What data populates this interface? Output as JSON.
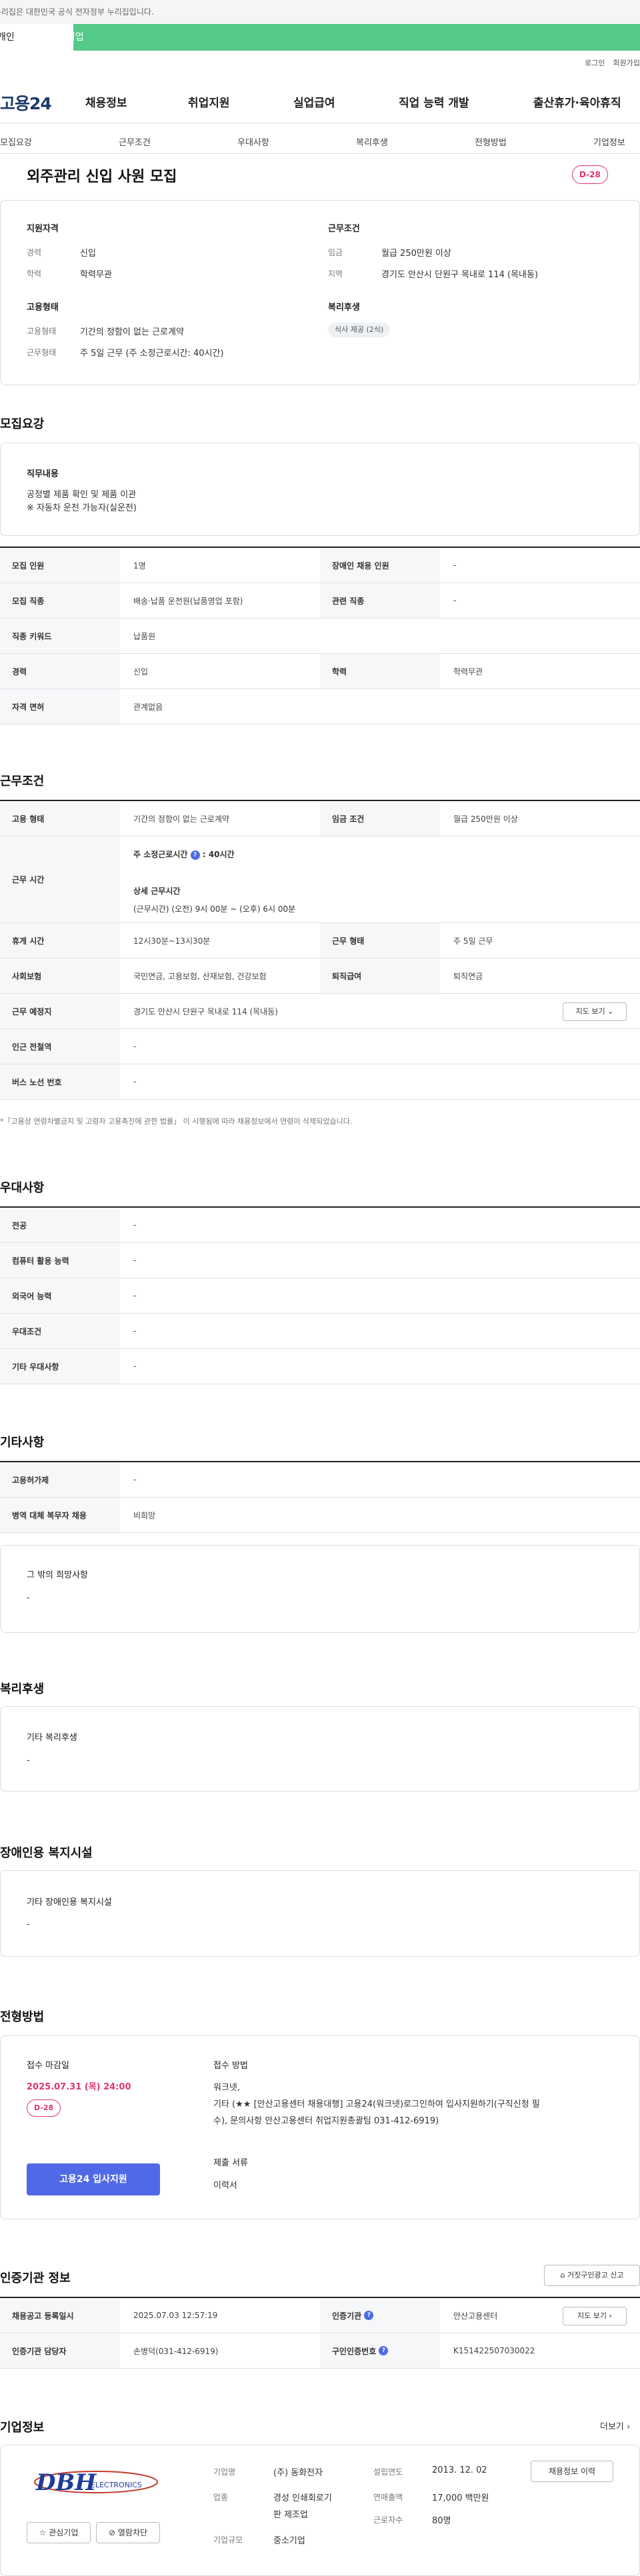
{
  "gov_banner": "이 누리집은 대한민국 공식 전자정부 누리집입니다.",
  "user_tabs": [
    "개인",
    "기업"
  ],
  "top_links": [
    "로그인",
    "회원가입"
  ],
  "logo": "고용24",
  "gnb": [
    "채용정보",
    "취업지원",
    "실업급여",
    "직업 능력 개발",
    "출산휴가·육아휴직"
  ],
  "lnb": [
    "모집요강",
    "근무조건",
    "우대사항",
    "복리후생",
    "전형방법",
    "기업정보"
  ],
  "title": "외주관리 신입 사원 모집",
  "dday": "D-28",
  "summary": {
    "qual_title": "지원자격",
    "career_l": "경력",
    "career_v": "신입",
    "edu_l": "학력",
    "edu_v": "학력무관",
    "cond_title": "근무조건",
    "wage_l": "임금",
    "wage_v": "월급 250만원 이상",
    "loc_l": "지역",
    "loc_v": "경기도 안산시 단원구 목내로 114 (목내동)",
    "emp_title": "고용형태",
    "type_l": "고용형태",
    "type_v": "기간의 정함이 없는 근로계약",
    "form_l": "근무형태",
    "form_v": "주 5일 근무 (주 소정근로시간: 40시간)",
    "welfare_title": "복리후생",
    "welfare_chip": "식사 제공 (2식)"
  },
  "recruit": {
    "title": "모집요강",
    "duty_l": "직무내용",
    "duty_1": "공정별 제품 확인 및 제품 이관",
    "duty_2": "※ 자동차 운전 가능자(실운전)",
    "rows": [
      [
        "모집 인원",
        "1명",
        "장애인 채용 인원",
        "-"
      ],
      [
        "모집 직종",
        "배송·납품 운전원(납품영업 포함)",
        "관련 직종",
        "-"
      ],
      [
        "직종 키워드",
        "납품원"
      ],
      [
        "경력",
        "신입",
        "학력",
        "학력무관"
      ],
      [
        "자격 면허",
        "관계없음"
      ]
    ]
  },
  "work": {
    "title": "근무조건",
    "r1": [
      "고용 형태",
      "기간의 정함이 없는 근로계약",
      "임금 조건",
      "월급 250만원 이상"
    ],
    "r2_l": "근무 시간",
    "r2_a": "주 소정근로시간",
    "r2_a2": ": 40시간",
    "r2_b": "상세 근무시간",
    "r2_c": "(근무시간) (오전) 9시 00분 ~ (오후) 6시 00분",
    "r3": [
      "휴게 시간",
      "12시30분~13시30분",
      "근무 형태",
      "주 5일 근무"
    ],
    "r4": [
      "사회보험",
      "국민연금, 고용보험, 산재보험, 건강보험",
      "퇴직급여",
      "퇴직연금"
    ],
    "r5": [
      "근무 예정지",
      "경기도 안산시 단원구 목내로 114 (목내동)"
    ],
    "map_btn": "지도 보기",
    "r6": [
      "인근 전철역",
      "-"
    ],
    "r7": [
      "버스 노선 번호",
      "-"
    ],
    "note": "「고용상 연령차별금지 및 고령자 고용촉진에 관한 법률」 이 시행됨에 따라 채용정보에서 연령이 삭제되었습니다."
  },
  "pref": {
    "title": "우대사항",
    "rows": [
      [
        "전공",
        "-"
      ],
      [
        "컴퓨터 활용 능력",
        "-"
      ],
      [
        "외국어 능력",
        "-"
      ],
      [
        "우대조건",
        "-"
      ],
      [
        "기타 우대사항",
        "-"
      ]
    ]
  },
  "etc": {
    "title": "기타사항",
    "rows": [
      [
        "고용허가제",
        "-"
      ],
      [
        "병역 대체 복무자 채용",
        "비희망"
      ]
    ],
    "box_l": "그 밖의 희망사항",
    "box_v": "-"
  },
  "welfare": {
    "title": "복리후생",
    "box_l": "기타 복리후생",
    "box_v": "-"
  },
  "disabled": {
    "title": "장애인용 복지시설",
    "box_l": "기타 장애인용 복지시설",
    "box_v": "-"
  },
  "screen": {
    "title": "전형방법",
    "dl_l": "접수 마감일",
    "dl_v": "2025.07.31 (목) 24:00",
    "dday": "D-28",
    "apply": "고용24 입사지원",
    "method_l": "접수 방법",
    "method_1": "워크넷,",
    "method_2": "기타 (★★ [안산고용센터 채용대행] 고용24(워크넷)로그인하여 입사지원하기(구직신청 필",
    "method_3": "수), 문의사항 안산고용센터 취업지원총괄팀 031-412-6919)",
    "docs_l": "제출 서류",
    "docs_v": "이력서"
  },
  "agency": {
    "title": "인증기관 정보",
    "report_btn": "거짓구인광고 신고",
    "r1": [
      "채용공고 등록일시",
      "2025.07.03 12:57:19",
      "인증기관",
      "안산고용센터"
    ],
    "r2": [
      "인증기관 담당자",
      "손병덕(031-412-6919)",
      "구인인증번호",
      "K151422507030022"
    ],
    "map_btn": "지도 보기"
  },
  "company": {
    "title": "기업정보",
    "more": "더보기",
    "logo_text": "DBH",
    "logo_sub": "ELECTRONICS",
    "fav": "관심기업",
    "block": "열람차단",
    "name_l": "기업명",
    "name_v": "(주) 동화전자",
    "ind_l": "업종",
    "ind_v1": "경성 인쇄회로기",
    "ind_v2": "판 제조업",
    "size_l": "기업규모",
    "size_v": "중소기업",
    "est_l": "설립연도",
    "est_v": "2013. 12. 02",
    "sales_l": "연매출액",
    "sales_v": "17,000 백만원",
    "emp_l": "근로자수",
    "emp_v": "80명",
    "jobs_btn": "채용정보 이력"
  }
}
